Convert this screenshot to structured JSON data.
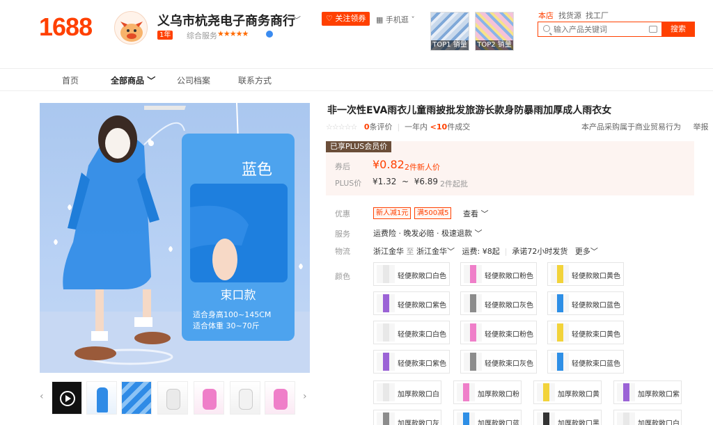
{
  "header": {
    "logo": "1688",
    "shop_name": "义乌市杭尧电子商务商行",
    "year_badge": "1年",
    "service_label": "综合服务",
    "stars": "★★★★★",
    "follow_label": "关注领券",
    "mobile_label": "手机逛",
    "top_thumbs": [
      "TOP1 销量",
      "TOP2 销量"
    ],
    "search_scopes": [
      "本店",
      "找货源",
      "找工厂"
    ],
    "search_placeholder": "输入产品关键词",
    "search_button": "搜索"
  },
  "nav": [
    "首页",
    "全部商品",
    "公司档案",
    "联系方式"
  ],
  "hero": {
    "color_title": "蓝色",
    "style_title": "束口款",
    "height_line": "适合身高100~145CM",
    "weight_line": "适合体重 30~70斤"
  },
  "product": {
    "title": "非一次性EVA雨衣儿童雨披批发旅游长款身防暴雨加厚成人雨衣女",
    "empty_stars": "☆☆☆☆☆",
    "eval_count": "0",
    "eval_label": "条评价",
    "sales_prefix": "一年内",
    "sales_count": "<10",
    "sales_suffix": "件成交",
    "trade_note": "本产品采购属于商业贸易行为",
    "report": "举报"
  },
  "price": {
    "plus_tag": "已享PLUS会员价",
    "coupon_label": "券后",
    "coupon_price": "¥0.82",
    "new_buyer": "2件新人价",
    "plus_label": "PLUS价",
    "plus_low": "¥1.32",
    "range_sep": "~",
    "plus_high": "¥6.89",
    "min_order": "2件起批"
  },
  "offers": {
    "label": "优惠",
    "tags": [
      "新人减1元",
      "满500减5"
    ],
    "more": "查看"
  },
  "service": {
    "label": "服务",
    "text": "运费险 · 晚发必赔 · 极速退款"
  },
  "logistics": {
    "label": "物流",
    "from": "浙江金华",
    "to_word": "至",
    "to": "浙江金华",
    "fee": "运费: ¥8起",
    "promise": "承诺72小时发货",
    "more": "更多"
  },
  "colors": {
    "label": "颜色",
    "skus": [
      {
        "label": "轻便款敞口白色",
        "color": "#e8e8e8"
      },
      {
        "label": "轻便款敞口粉色",
        "color": "#ef7fc9"
      },
      {
        "label": "轻便款敞口黄色",
        "color": "#f2d33a"
      },
      {
        "label": "轻便款敞口紫色",
        "color": "#9b63d6"
      },
      {
        "label": "轻便款敞口灰色",
        "color": "#8c8c8c"
      },
      {
        "label": "轻便款敞口蓝色",
        "color": "#2e8fe6"
      },
      {
        "label": "轻便款束口白色",
        "color": "#e8e8e8"
      },
      {
        "label": "轻便款束口粉色",
        "color": "#ef7fc9"
      },
      {
        "label": "轻便款束口黄色",
        "color": "#f2d33a"
      },
      {
        "label": "轻便款束口紫色",
        "color": "#9b63d6"
      },
      {
        "label": "轻便款束口灰色",
        "color": "#8c8c8c"
      },
      {
        "label": "轻便款束口蓝色",
        "color": "#2e8fe6"
      },
      {
        "label": "加厚款敞口白",
        "color": "#e8e8e8"
      },
      {
        "label": "加厚款敞口粉",
        "color": "#ef7fc9"
      },
      {
        "label": "加厚款敞口黄",
        "color": "#f2d33a"
      },
      {
        "label": "加厚款敞口紫",
        "color": "#9b63d6"
      },
      {
        "label": "加厚款敞口灰",
        "color": "#8c8c8c"
      },
      {
        "label": "加厚款敞口蓝",
        "color": "#2e8fe6"
      },
      {
        "label": "加厚款敞口黑",
        "color": "#333333"
      },
      {
        "label": "加厚款敞口白",
        "color": "#e8e8e8"
      }
    ]
  }
}
